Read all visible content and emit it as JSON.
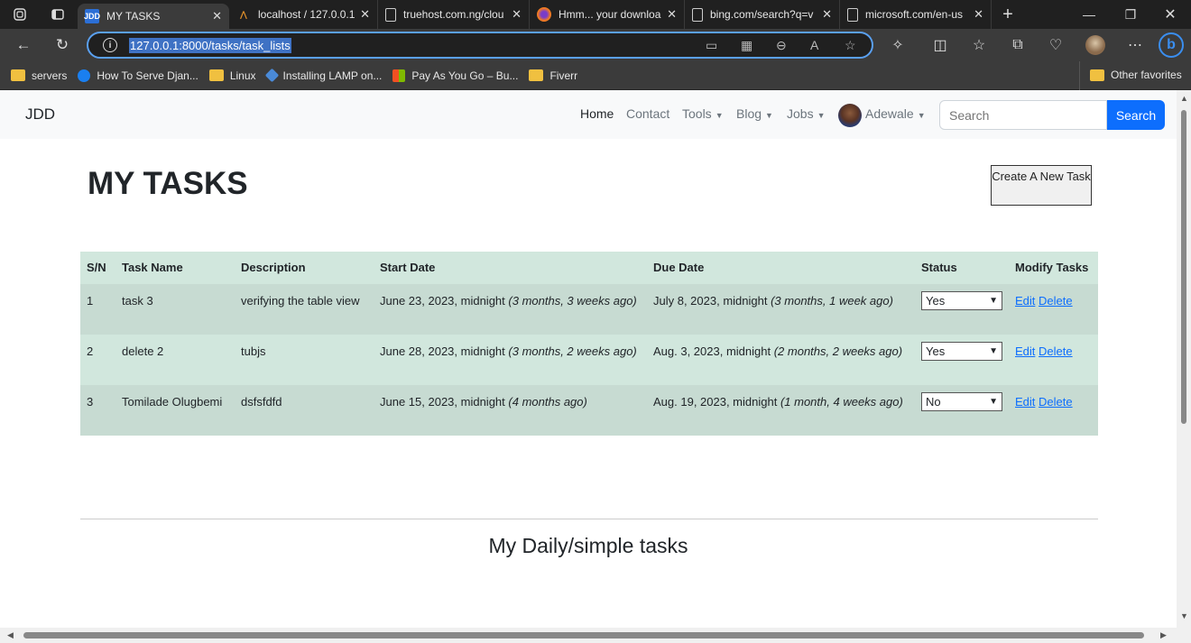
{
  "browser": {
    "tabs": [
      {
        "title": "MY TASKS",
        "favicon_text": "JDD",
        "active": true
      },
      {
        "title": "localhost / 127.0.0.1 |",
        "active": false
      },
      {
        "title": "truehost.com.ng/clou",
        "active": false
      },
      {
        "title": "Hmm... your downloa",
        "active": false
      },
      {
        "title": "bing.com/search?q=v",
        "active": false
      },
      {
        "title": "microsoft.com/en-us",
        "active": false
      }
    ],
    "new_tab": "+",
    "url": "127.0.0.1:8000/tasks/task_lists",
    "bookmarks": [
      {
        "label": "servers",
        "icon": "folder-icon"
      },
      {
        "label": "How To Serve Djan...",
        "icon": "digitalocean-icon"
      },
      {
        "label": "Linux",
        "icon": "folder-icon"
      },
      {
        "label": "Installing LAMP on...",
        "icon": "diamond-icon"
      },
      {
        "label": "Pay As You Go – Bu...",
        "icon": "microsoft-icon"
      },
      {
        "label": "Fiverr",
        "icon": "folder-icon"
      }
    ],
    "other_favorites": "Other favorites"
  },
  "navbar": {
    "brand": "JDD",
    "links": {
      "home": "Home",
      "contact": "Contact",
      "tools": "Tools",
      "blog": "Blog",
      "jobs": "Jobs",
      "user": "Adewale"
    },
    "search_placeholder": "Search",
    "search_button": "Search"
  },
  "main": {
    "title": "MY TASKS",
    "create_button": "Create A New Task",
    "table": {
      "headers": {
        "sn": "S/N",
        "name": "Task Name",
        "description": "Description",
        "start": "Start Date",
        "due": "Due Date",
        "status": "Status",
        "modify": "Modify Tasks"
      },
      "rows": [
        {
          "sn": "1",
          "name": "task 3",
          "description": "verifying the table view",
          "start": "June 23, 2023, midnight",
          "start_ago": "(3 months, 3 weeks ago)",
          "due": "July 8, 2023, midnight",
          "due_ago": "(3 months, 1 week ago)",
          "status": "Yes",
          "edit": "Edit",
          "delete": "Delete"
        },
        {
          "sn": "2",
          "name": "delete 2",
          "description": "tubjs",
          "start": "June 28, 2023, midnight",
          "start_ago": "(3 months, 2 weeks ago)",
          "due": "Aug. 3, 2023, midnight",
          "due_ago": "(2 months, 2 weeks ago)",
          "status": "Yes",
          "edit": "Edit",
          "delete": "Delete"
        },
        {
          "sn": "3",
          "name": "Tomilade Olugbemi",
          "description": "dsfsfdfd",
          "start": "June 15, 2023, midnight",
          "start_ago": "(4 months ago)",
          "due": "Aug. 19, 2023, midnight",
          "due_ago": "(1 month, 4 weeks ago)",
          "status": "No",
          "edit": "Edit",
          "delete": "Delete"
        }
      ]
    },
    "daily_heading": "My Daily/simple tasks"
  }
}
